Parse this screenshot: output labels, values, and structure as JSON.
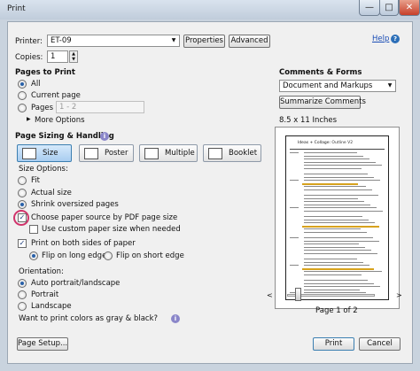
{
  "window": {
    "title": "Print",
    "min": "—",
    "max": "□",
    "close": "✕"
  },
  "printer": {
    "label": "Printer:",
    "value": "ET-09",
    "properties": "Properties",
    "advanced": "Advanced",
    "help": "Help"
  },
  "copies": {
    "label": "Copies:",
    "value": "1"
  },
  "pages": {
    "header": "Pages to Print",
    "all": "All",
    "current": "Current page",
    "pages": "Pages",
    "range_placeholder": "1 - 2",
    "more": "More Options"
  },
  "sizing": {
    "header": "Page Sizing & Handling",
    "size": "Size",
    "poster": "Poster",
    "multiple": "Multiple",
    "booklet": "Booklet",
    "options_label": "Size Options:",
    "fit": "Fit",
    "actual": "Actual size",
    "shrink": "Shrink oversized pages",
    "choose_source": "Choose paper source by PDF page size",
    "custom_size": "Use custom paper size when needed",
    "both_sides": "Print on both sides of paper",
    "flip_long": "Flip on long edge",
    "flip_short": "Flip on short edge"
  },
  "orientation": {
    "label": "Orientation:",
    "auto": "Auto portrait/landscape",
    "portrait": "Portrait",
    "landscape": "Landscape"
  },
  "gray_question": "Want to print colors as gray & black?",
  "comments": {
    "header": "Comments & Forms",
    "value": "Document and Markups",
    "summarize": "Summarize Comments"
  },
  "preview": {
    "size": "8.5 x 11 Inches",
    "doc_title_part1": "Ideas + Collage: ",
    "doc_title_part2": "Outline V2",
    "page_info": "Page 1 of 2"
  },
  "buttons": {
    "page_setup": "Page Setup...",
    "print": "Print",
    "cancel": "Cancel"
  },
  "colors": {
    "accent": "#2860a8",
    "highlight_ring": "#d0336b"
  }
}
